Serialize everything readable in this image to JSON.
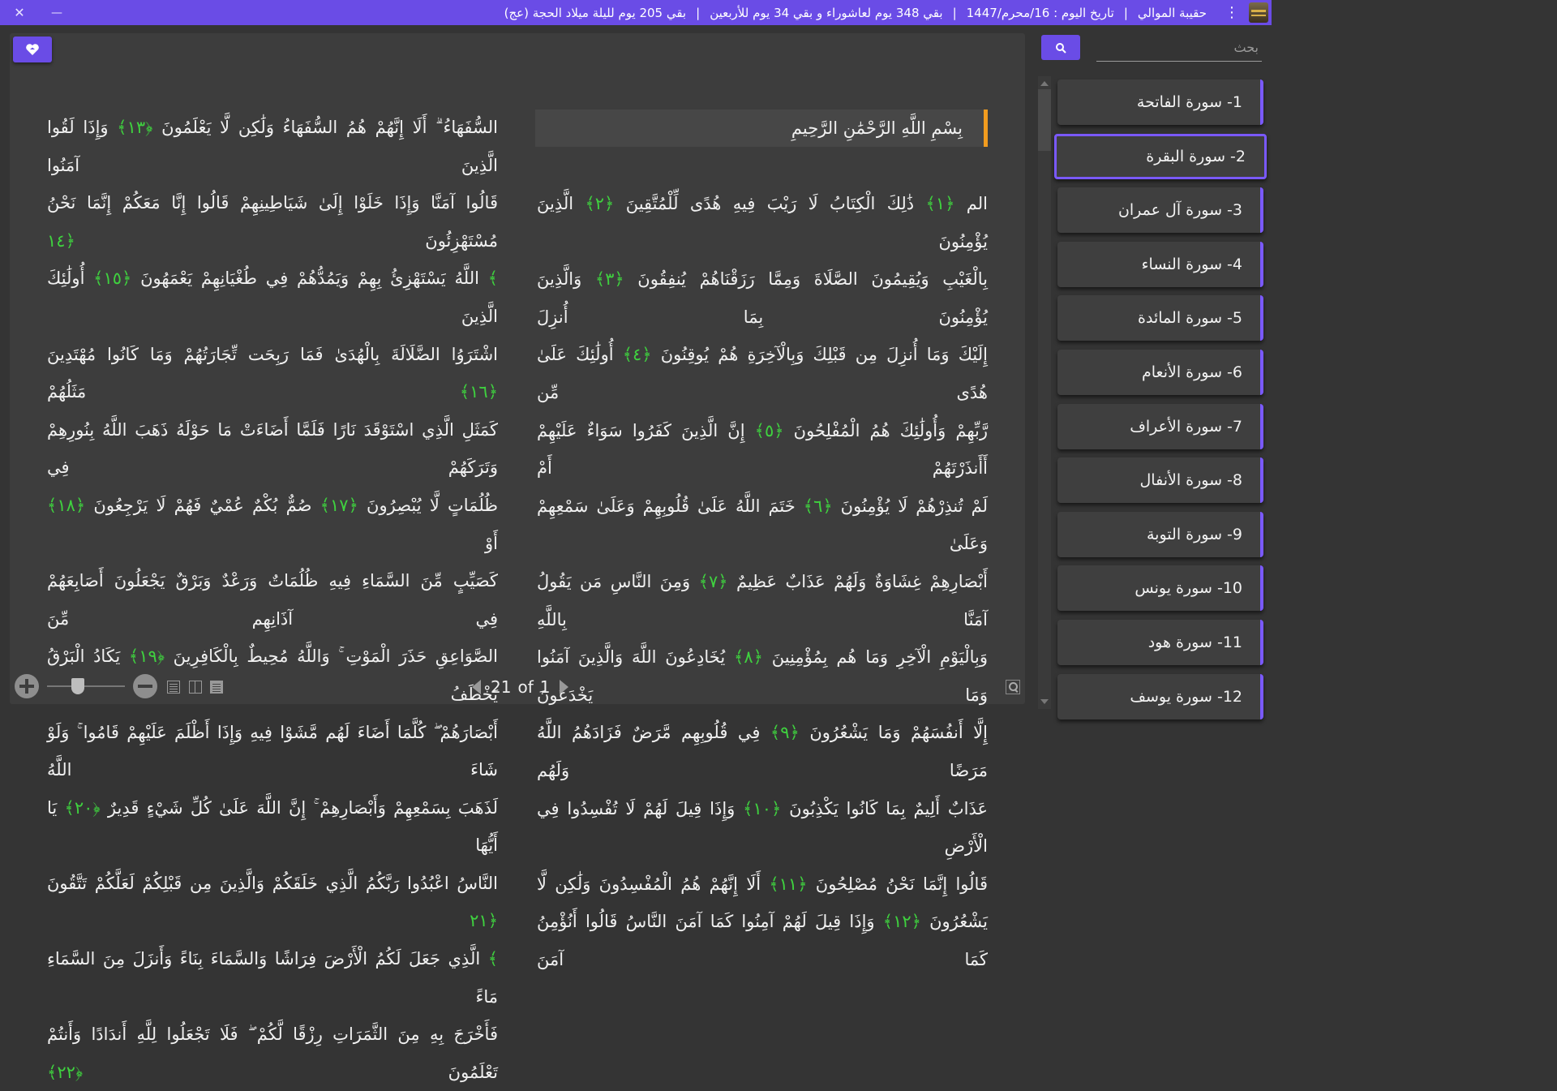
{
  "titlebar": {
    "app_name": "حقيبة الموالي",
    "date_text": "تاريخ اليوم : 16/محرم/1447",
    "countdown_ashura": "بقي 348 يوم لعاشوراء و بقي 34 يوم للأربعين",
    "countdown_birth": "بقي 205 يوم لليلة ميلاد الحجة (عج)",
    "separator": "|",
    "close_glyph": "✕",
    "minimize_glyph": "—",
    "menu_glyph": "⋮"
  },
  "search": {
    "placeholder": "بحث",
    "button_icon": "search-icon"
  },
  "reader": {
    "basmala": "بِسْمِ اللَّهِ الرَّحْمَٰنِ الرَّحِيمِ",
    "right_page_lines": [
      [
        "الم ",
        "﴿١﴾",
        " ذَٰلِكَ الْكِتَابُ لَا رَيْبَ فِيهِ هُدًى لِّلْمُتَّقِينَ ",
        "﴿٢﴾",
        " الَّذِينَ يُؤْمِنُونَ"
      ],
      [
        "بِالْغَيْبِ وَيُقِيمُونَ الصَّلَاةَ وَمِمَّا رَزَقْنَاهُمْ يُنفِقُونَ ",
        "﴿٣﴾",
        " وَالَّذِينَ يُؤْمِنُونَ بِمَا أُنزِلَ"
      ],
      [
        "إِلَيْكَ وَمَا أُنزِلَ مِن قَبْلِكَ وَبِالْآخِرَةِ هُمْ يُوقِنُونَ ",
        "﴿٤﴾",
        " أُولَٰئِكَ عَلَىٰ هُدًى مِّن"
      ],
      [
        "رَّبِّهِمْ وَأُولَٰئِكَ هُمُ الْمُفْلِحُونَ ",
        "﴿٥﴾",
        " إِنَّ الَّذِينَ كَفَرُوا سَوَاءٌ عَلَيْهِمْ أَأَنذَرْتَهُمْ أَمْ"
      ],
      [
        "لَمْ تُنذِرْهُمْ لَا يُؤْمِنُونَ ",
        "﴿٦﴾",
        " خَتَمَ اللَّهُ عَلَىٰ قُلُوبِهِمْ وَعَلَىٰ سَمْعِهِمْ وَعَلَىٰ"
      ],
      [
        "أَبْصَارِهِمْ غِشَاوَةٌ وَلَهُمْ عَذَابٌ عَظِيمٌ ",
        "﴿٧﴾",
        " وَمِنَ النَّاسِ مَن يَقُولُ آمَنَّا بِاللَّهِ"
      ],
      [
        "وَبِالْيَوْمِ الْآخِرِ وَمَا هُم بِمُؤْمِنِينَ ",
        "﴿٨﴾",
        " يُخَادِعُونَ اللَّهَ وَالَّذِينَ آمَنُوا وَمَا يَخْدَعُونَ"
      ],
      [
        "إِلَّا أَنفُسَهُمْ وَمَا يَشْعُرُونَ ",
        "﴿٩﴾",
        " فِي قُلُوبِهِم مَّرَضٌ فَزَادَهُمُ اللَّهُ مَرَضًا وَلَهُم"
      ],
      [
        "عَذَابٌ أَلِيمٌ بِمَا كَانُوا يَكْذِبُونَ ",
        "﴿١٠﴾",
        " وَإِذَا قِيلَ لَهُمْ لَا تُفْسِدُوا فِي الْأَرْضِ"
      ],
      [
        "قَالُوا إِنَّمَا نَحْنُ مُصْلِحُونَ ",
        "﴿١١﴾",
        " أَلَا إِنَّهُمْ هُمُ الْمُفْسِدُونَ وَلَٰكِن لَّا"
      ],
      [
        "يَشْعُرُونَ ",
        "﴿١٢﴾",
        " وَإِذَا قِيلَ لَهُمْ آمِنُوا كَمَا آمَنَ النَّاسُ قَالُوا أَنُؤْمِنُ كَمَا آمَنَ"
      ]
    ],
    "left_page_lines": [
      [
        "السُّفَهَاءُ ۗ أَلَا إِنَّهُمْ هُمُ السُّفَهَاءُ وَلَٰكِن لَّا يَعْلَمُونَ ",
        "﴿١٣﴾",
        " وَإِذَا لَقُوا الَّذِينَ آمَنُوا"
      ],
      [
        "قَالُوا آمَنَّا وَإِذَا خَلَوْا إِلَىٰ شَيَاطِينِهِمْ قَالُوا إِنَّا مَعَكُمْ إِنَّمَا نَحْنُ مُسْتَهْزِئُونَ ",
        "﴿١٤"
      ],
      [
        "﴾",
        " اللَّهُ يَسْتَهْزِئُ بِهِمْ وَيَمُدُّهُمْ فِي طُغْيَانِهِمْ يَعْمَهُونَ ",
        "﴿١٥﴾",
        " أُولَٰئِكَ الَّذِينَ"
      ],
      [
        "اشْتَرَوُا الضَّلَالَةَ بِالْهُدَىٰ فَمَا رَبِحَت تِّجَارَتُهُمْ وَمَا كَانُوا مُهْتَدِينَ ",
        "﴿١٦﴾",
        " مَثَلُهُمْ"
      ],
      [
        "كَمَثَلِ الَّذِي اسْتَوْقَدَ نَارًا فَلَمَّا أَضَاءَتْ مَا حَوْلَهُ ذَهَبَ اللَّهُ بِنُورِهِمْ وَتَرَكَهُمْ فِي"
      ],
      [
        "ظُلُمَاتٍ لَّا يُبْصِرُونَ ",
        "﴿١٧﴾",
        " صُمٌّ بُكْمٌ عُمْيٌ فَهُمْ لَا يَرْجِعُونَ ",
        "﴿١٨﴾",
        " أَوْ"
      ],
      [
        "كَصَيِّبٍ مِّنَ السَّمَاءِ فِيهِ ظُلُمَاتٌ وَرَعْدٌ وَبَرْقٌ يَجْعَلُونَ أَصَابِعَهُمْ فِي آذَانِهِم مِّنَ"
      ],
      [
        "الصَّوَاعِقِ حَذَرَ الْمَوْتِ ۚ وَاللَّهُ مُحِيطٌ بِالْكَافِرِينَ ",
        "﴿١٩﴾",
        " يَكَادُ الْبَرْقُ يَخْطَفُ"
      ],
      [
        "أَبْصَارَهُمْ ۖ كُلَّمَا أَضَاءَ لَهُم مَّشَوْا فِيهِ وَإِذَا أَظْلَمَ عَلَيْهِمْ قَامُوا ۚ وَلَوْ شَاءَ اللَّهُ"
      ],
      [
        "لَذَهَبَ بِسَمْعِهِمْ وَأَبْصَارِهِمْ ۚ إِنَّ اللَّهَ عَلَىٰ كُلِّ شَيْءٍ قَدِيرٌ ",
        "﴿٢٠﴾",
        " يَا أَيُّهَا"
      ],
      [
        "النَّاسُ اعْبُدُوا رَبَّكُمُ الَّذِي خَلَقَكُمْ وَالَّذِينَ مِن قَبْلِكُمْ لَعَلَّكُمْ تَتَّقُونَ ",
        "﴿٢١"
      ],
      [
        "﴾",
        " الَّذِي جَعَلَ لَكُمُ الْأَرْضَ فِرَاشًا وَالسَّمَاءَ بِنَاءً وَأَنزَلَ مِنَ السَّمَاءِ مَاءً"
      ],
      [
        "فَأَخْرَجَ بِهِ مِنَ الثَّمَرَاتِ رِزْقًا لَّكُمْ ۖ فَلَا تَجْعَلُوا لِلَّهِ أَندَادًا وَأَنتُمْ تَعْلَمُونَ ",
        "﴿٢٢﴾"
      ]
    ],
    "current_page": "21",
    "of_label": "of",
    "total_pages": "1",
    "zoom_level": 0.4
  },
  "colors": {
    "accent": "#6a4ce6",
    "ayah_number": "#3fd13f",
    "basmala_marker": "#f29c1f"
  },
  "surahs": [
    "1- سورة الفاتحة",
    "2- سورة البقرة",
    "3- سورة آل عمران",
    "4- سورة النساء",
    "5- سورة المائدة",
    "6- سورة الأنعام",
    "7- سورة الأعراف",
    "8- سورة الأنفال",
    "9- سورة التوبة",
    "10- سورة يونس",
    "11- سورة هود",
    "12- سورة يوسف"
  ],
  "active_surah": 1
}
